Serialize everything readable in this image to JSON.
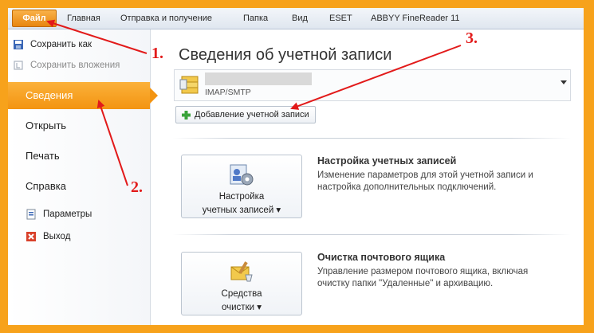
{
  "ribbon": {
    "tabs": [
      "Файл",
      "Главная",
      "Отправка и получение",
      "Папка",
      "Вид",
      "ESET",
      "ABBYY FineReader 11"
    ]
  },
  "nav": {
    "save_as": "Сохранить как",
    "save_attachments": "Сохранить вложения",
    "info": "Сведения",
    "open": "Открыть",
    "print": "Печать",
    "help": "Справка",
    "options": "Параметры",
    "exit": "Выход"
  },
  "main": {
    "title": "Сведения об учетной записи",
    "account_type": "IMAP/SMTP",
    "add_account": "Добавление учетной записи",
    "account_settings": {
      "btn_line1": "Настройка",
      "btn_line2": "учетных записей ▾",
      "title": "Настройка учетных записей",
      "description": "Изменение параметров для этой учетной записи и настройка дополнительных подключений."
    },
    "cleanup": {
      "btn_line1": "Средства",
      "btn_line2": "очистки ▾",
      "title": "Очистка почтового ящика",
      "description": "Управление размером почтового ящика, включая очистку папки \"Удаленные\" и архивацию."
    }
  },
  "annotations": {
    "step1": "1.",
    "step2": "2.",
    "step3": "3."
  },
  "colors": {
    "frame": "#f7a21b",
    "file_tab": "#e8860f",
    "selected_nav": "#f39411",
    "arrows": "#e21a1a"
  }
}
